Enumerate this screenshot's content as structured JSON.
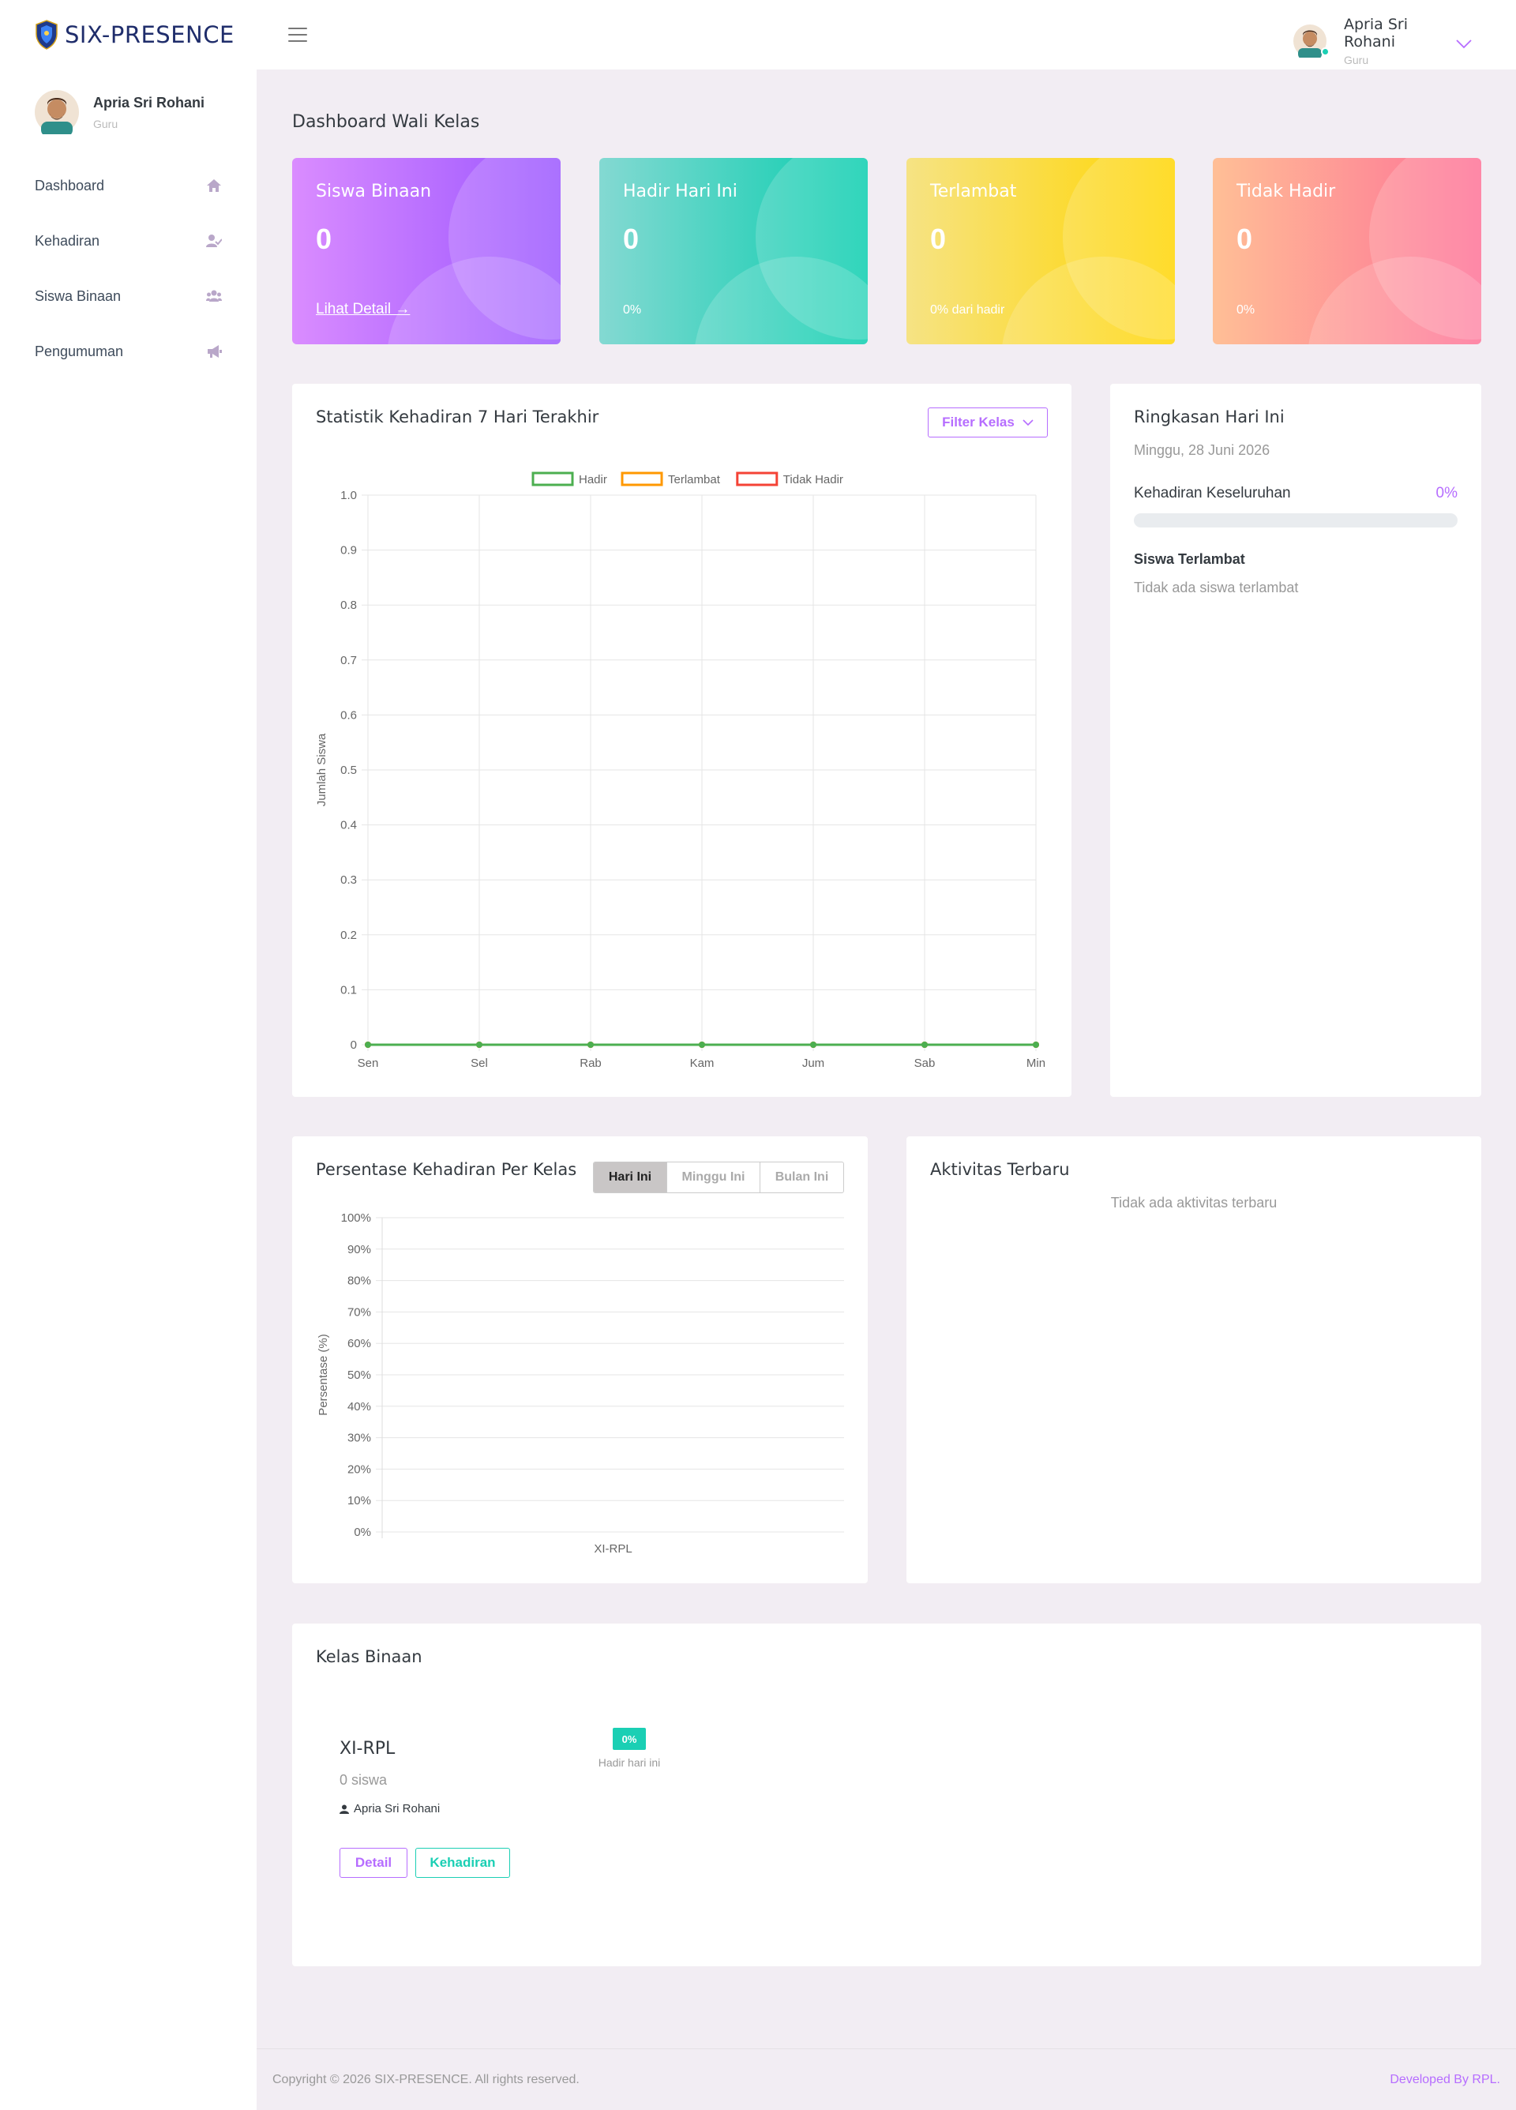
{
  "brand": {
    "name": "SIX-PRESENCE"
  },
  "navbar": {
    "user_name": "Apria Sri Rohani",
    "user_role": "Guru"
  },
  "sidebar": {
    "profile_name": "Apria Sri Rohani",
    "profile_role": "Guru",
    "items": [
      {
        "label": "Dashboard",
        "icon": "home-icon"
      },
      {
        "label": "Kehadiran",
        "icon": "user-check-icon"
      },
      {
        "label": "Siswa Binaan",
        "icon": "users-icon"
      },
      {
        "label": "Pengumuman",
        "icon": "megaphone-icon"
      }
    ]
  },
  "page": {
    "title": "Dashboard Wali Kelas"
  },
  "stats": [
    {
      "title": "Siswa Binaan",
      "value": "0",
      "footer": "Lihat Detail →"
    },
    {
      "title": "Hadir Hari Ini",
      "value": "0",
      "footer": "0%"
    },
    {
      "title": "Terlambat",
      "value": "0",
      "footer": "0% dari hadir"
    },
    {
      "title": "Tidak Hadir",
      "value": "0",
      "footer": "0%"
    }
  ],
  "weekly": {
    "title": "Statistik Kehadiran 7 Hari Terakhir",
    "filter_label": "Filter Kelas"
  },
  "summary": {
    "title": "Ringkasan Hari Ini",
    "date": "Minggu, 28 Juni 2026",
    "overall_label": "Kehadiran Keseluruhan",
    "overall_pct": "0%",
    "overall_value": 0,
    "late_title": "Siswa Terlambat",
    "late_empty": "Tidak ada siswa terlambat"
  },
  "per_class": {
    "title": "Persentase Kehadiran Per Kelas",
    "tabs": [
      "Hari Ini",
      "Minggu Ini",
      "Bulan Ini"
    ]
  },
  "activity": {
    "title": "Aktivitas Terbaru",
    "empty": "Tidak ada aktivitas terbaru"
  },
  "kelas": {
    "title": "Kelas Binaan",
    "name": "XI-RPL",
    "count": "0 siswa",
    "teacher": "Apria Sri Rohani",
    "badge": "0%",
    "badge_label": "Hadir hari ini",
    "detail_label": "Detail",
    "attendance_label": "Kehadiran"
  },
  "footer": {
    "copyright": "Copyright © 2026 SIX-PRESENCE. All rights reserved.",
    "developer": "Developed By RPL."
  },
  "colors": {
    "primary": "#b66dff",
    "success": "#1bcfb4",
    "hadir": "#4caf50",
    "terlambat": "#ff9800",
    "tidak_hadir": "#f44336"
  },
  "chart_data": [
    {
      "type": "line",
      "title": "",
      "xlabel": "",
      "ylabel": "Jumlah Siswa",
      "categories": [
        "Sen",
        "Sel",
        "Rab",
        "Kam",
        "Jum",
        "Sab",
        "Min"
      ],
      "ylim": [
        0,
        1
      ],
      "yticks": [
        "0",
        "0.1",
        "0.2",
        "0.3",
        "0.4",
        "0.5",
        "0.6",
        "0.7",
        "0.8",
        "0.9",
        "1.0"
      ],
      "grid": true,
      "legend": "top",
      "series": [
        {
          "name": "Hadir",
          "color": "#4caf50",
          "values": [
            0,
            0,
            0,
            0,
            0,
            0,
            0
          ]
        },
        {
          "name": "Terlambat",
          "color": "#ff9800",
          "values": [
            0,
            0,
            0,
            0,
            0,
            0,
            0
          ]
        },
        {
          "name": "Tidak Hadir",
          "color": "#f44336",
          "values": [
            0,
            0,
            0,
            0,
            0,
            0,
            0
          ]
        }
      ]
    },
    {
      "type": "bar",
      "title": "",
      "xlabel": "",
      "ylabel": "Persentase (%)",
      "categories": [
        "XI-RPL"
      ],
      "values": [
        0
      ],
      "ylim": [
        0,
        100
      ],
      "yticks": [
        "0%",
        "10%",
        "20%",
        "30%",
        "40%",
        "50%",
        "60%",
        "70%",
        "80%",
        "90%",
        "100%"
      ],
      "grid": true
    }
  ]
}
